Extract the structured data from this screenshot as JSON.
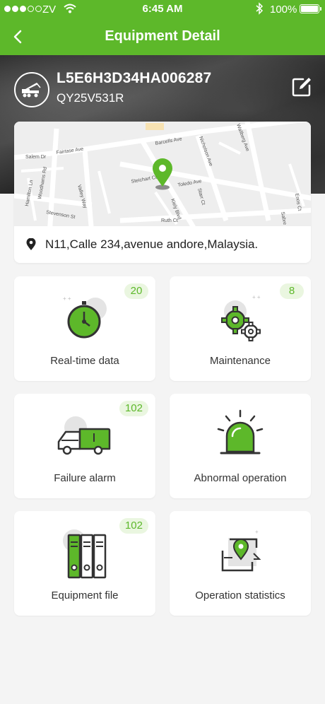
{
  "status_bar": {
    "carrier": "ZV",
    "time": "6:45 AM",
    "battery": "100%"
  },
  "nav": {
    "title": "Equipment Detail",
    "back_icon": "chevron-left-icon"
  },
  "equipment": {
    "id": "L5E6H3D34HA006287",
    "model": "QY25V531R",
    "avatar_icon": "crane-truck-icon",
    "edit_icon": "edit-icon"
  },
  "map": {
    "streets": [
      "Fairtase Ave",
      "Salem Dr",
      "Woodhams Rd",
      "Hamilton Ln",
      "Valley Way",
      "Stevenson St",
      "Barcells Ave",
      "Nicholson Ave",
      "Steichart Ct",
      "Toledo Ave",
      "Starr Ct",
      "Kiely Blvd",
      "Ruth Ct",
      "Wallberg Ave",
      "Enos Ct",
      "Sabre"
    ],
    "pin_icon": "location-pin-icon"
  },
  "address": "N11,Calle 234,avenue andore,Malaysia.",
  "tiles": [
    {
      "label": "Real-time data",
      "badge": "20",
      "icon": "stopwatch-icon"
    },
    {
      "label": "Maintenance",
      "badge": "8",
      "icon": "gears-icon"
    },
    {
      "label": "Failure alarm",
      "badge": "102",
      "icon": "truck-icon"
    },
    {
      "label": "Abnormal operation",
      "badge": "",
      "icon": "siren-icon"
    },
    {
      "label": "Equipment file",
      "badge": "102",
      "icon": "binders-icon"
    },
    {
      "label": "Operation statistics",
      "badge": "",
      "icon": "map-statistics-icon"
    }
  ],
  "colors": {
    "brand_green": "#5db82a",
    "badge_bg": "#eaf6e0"
  }
}
